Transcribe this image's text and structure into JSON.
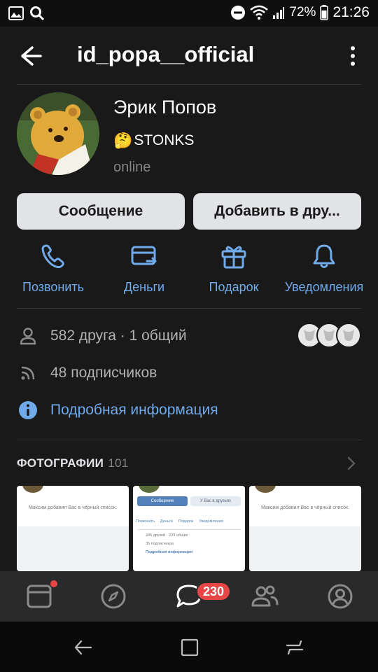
{
  "status_bar": {
    "battery_percent": "72%",
    "time": "21:26"
  },
  "header": {
    "title": "id_popa__official"
  },
  "profile": {
    "name": "Эрик Попов",
    "status_emoji": "🤔",
    "status_text": "STONKS",
    "online_text": "online"
  },
  "buttons": {
    "message": "Сообщение",
    "add_friend": "Добавить в дру..."
  },
  "actions": [
    {
      "label": "Позвонить",
      "icon": "phone-icon"
    },
    {
      "label": "Деньги",
      "icon": "money-transfer-icon"
    },
    {
      "label": "Подарок",
      "icon": "gift-icon"
    },
    {
      "label": "Уведомления",
      "icon": "bell-icon"
    }
  ],
  "info": {
    "friends_text": "582 друга · 1 общий",
    "followers_text": "48 подписчиков",
    "details_link": "Подробная информация"
  },
  "photos": {
    "title": "ФОТОГРАФИИ",
    "count": "101"
  },
  "thumbs": {
    "t1_text": "Максим добавил Вас в чёрный список.",
    "t2_btn1": "Сообщение",
    "t2_btn2": "У Вас в друзьях",
    "t2_a1": "Позвонить",
    "t2_a2": "Деньги",
    "t2_a3": "Подарок",
    "t2_a4": "Уведомления",
    "t2_friends": "445 друзей · 229 общих",
    "t2_followers": "35 подписчиков",
    "t2_details": "Подробная информация",
    "t3_text": "Максим добавил Вас в чёрный список."
  },
  "bottom_nav": {
    "messages_badge": "230"
  },
  "colors": {
    "accent": "#71aaeb",
    "background": "#191919",
    "badge": "#e64646"
  }
}
